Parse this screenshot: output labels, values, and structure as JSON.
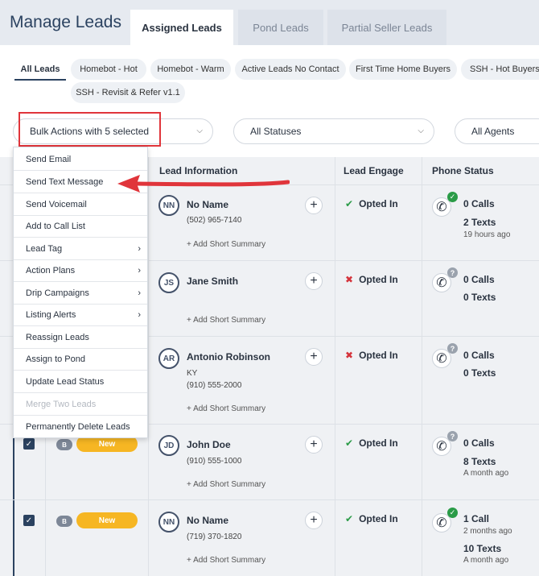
{
  "header": {
    "title": "Manage Leads",
    "tabs": [
      {
        "label": "Assigned Leads",
        "active": true
      },
      {
        "label": "Pond Leads",
        "active": false
      },
      {
        "label": "Partial Seller Leads",
        "active": false
      }
    ]
  },
  "filters": {
    "chips": [
      "All Leads",
      "Homebot - Hot",
      "Homebot - Warm",
      "Active Leads No Contact",
      "First Time Home Buyers",
      "SSH - Hot Buyers N",
      "SSH - Revisit & Refer v1.1"
    ]
  },
  "toolbar": {
    "bulk_actions": "Bulk Actions with 5 selected",
    "statuses": "All Statuses",
    "agents": "All Agents"
  },
  "bulk_menu": {
    "items": [
      {
        "label": "Send Email",
        "submenu": false,
        "disabled": false
      },
      {
        "label": "Send Text Message",
        "submenu": false,
        "disabled": false
      },
      {
        "label": "Send Voicemail",
        "submenu": false,
        "disabled": false
      },
      {
        "label": "Add to Call List",
        "submenu": false,
        "disabled": false
      },
      {
        "label": "Lead Tag",
        "submenu": true,
        "disabled": false
      },
      {
        "label": "Action Plans",
        "submenu": true,
        "disabled": false
      },
      {
        "label": "Drip Campaigns",
        "submenu": true,
        "disabled": false
      },
      {
        "label": "Listing Alerts",
        "submenu": true,
        "disabled": false
      },
      {
        "label": "Reassign Leads",
        "submenu": false,
        "disabled": false
      },
      {
        "label": "Assign to Pond",
        "submenu": false,
        "disabled": false
      },
      {
        "label": "Update Lead Status",
        "submenu": false,
        "disabled": false
      },
      {
        "label": "Merge Two Leads",
        "submenu": false,
        "disabled": true
      },
      {
        "label": "Permanently Delete Leads",
        "submenu": false,
        "disabled": false
      }
    ]
  },
  "table": {
    "columns": [
      "Lead Information",
      "Lead Engage",
      "Phone Status"
    ],
    "summary_label": "+ Add Short Summary",
    "rows": [
      {
        "initials": "NN",
        "name": "No Name",
        "line1": "(502) 965-7140",
        "line2": "",
        "engage": "Opted In",
        "engage_ok": true,
        "phone_badge": "check",
        "calls": "0 Calls",
        "calls_ago": "",
        "texts": "2 Texts",
        "texts_ago": "19 hours ago",
        "tag": "",
        "status": ""
      },
      {
        "initials": "JS",
        "name": "Jane Smith",
        "line1": "",
        "line2": "",
        "engage": "Opted In",
        "engage_ok": false,
        "phone_badge": "question",
        "calls": "0 Calls",
        "calls_ago": "",
        "texts": "0 Texts",
        "texts_ago": "",
        "tag": "",
        "status": ""
      },
      {
        "initials": "AR",
        "name": "Antonio Robinson",
        "line1": "KY",
        "line2": "(910) 555-2000",
        "engage": "Opted In",
        "engage_ok": false,
        "phone_badge": "question",
        "calls": "0 Calls",
        "calls_ago": "",
        "texts": "0 Texts",
        "texts_ago": "",
        "tag": "",
        "status": ""
      },
      {
        "initials": "JD",
        "name": "John Doe",
        "line1": "(910) 555-1000",
        "line2": "",
        "engage": "Opted In",
        "engage_ok": true,
        "phone_badge": "question",
        "calls": "0 Calls",
        "calls_ago": "",
        "texts": "8 Texts",
        "texts_ago": "A month ago",
        "tag": "B",
        "status": "New"
      },
      {
        "initials": "NN",
        "name": "No Name",
        "line1": "(719) 370-1820",
        "line2": "",
        "engage": "Opted In",
        "engage_ok": true,
        "phone_badge": "check",
        "calls": "1 Call",
        "calls_ago": "2 months ago",
        "texts": "10 Texts",
        "texts_ago": "A month ago",
        "tag": "B",
        "status": "New"
      }
    ]
  },
  "colors": {
    "accent": "#2b4260",
    "annotation_red": "#e0353b",
    "new_badge": "#f6b623",
    "opted_in_ok": "#2a9b47",
    "opted_in_no": "#d4333b"
  }
}
